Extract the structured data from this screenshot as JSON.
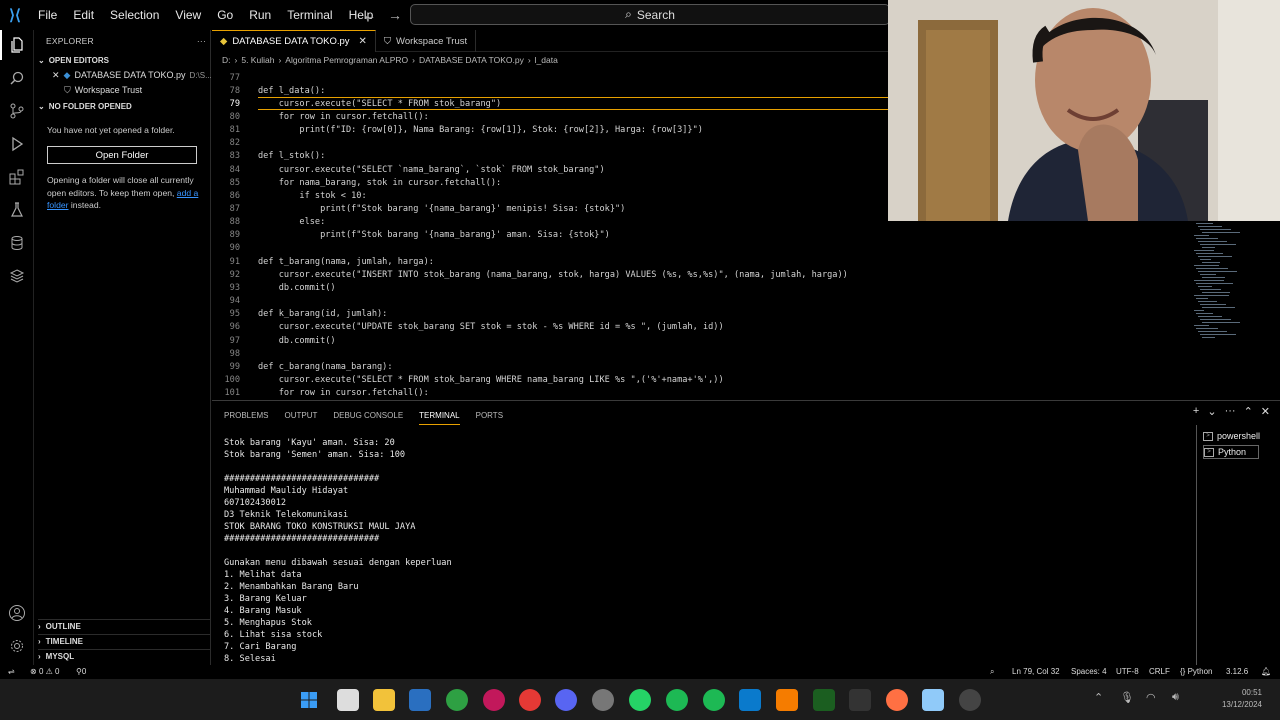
{
  "titlebar": {
    "menu": [
      "File",
      "Edit",
      "Selection",
      "View",
      "Go",
      "Run",
      "Terminal",
      "Help"
    ],
    "search": "Search"
  },
  "sidebar": {
    "title": "EXPLORER",
    "more": "···",
    "open_editors_label": "OPEN EDITORS",
    "open_editors": [
      {
        "name": "DATABASE DATA TOKO.py",
        "path": "D:\\S..."
      },
      {
        "name": "Workspace Trust",
        "path": ""
      }
    ],
    "no_folder_label": "NO FOLDER OPENED",
    "msg1": "You have not yet opened a folder.",
    "open_folder_button": "Open Folder",
    "msg2_pre": "Opening a folder will close all currently open editors. To keep them open, ",
    "msg2_link": "add a folder",
    "msg2_post": " instead.",
    "outline": "OUTLINE",
    "timeline": "TIMELINE",
    "mysql": "MYSQL"
  },
  "tabs": [
    {
      "label": "DATABASE DATA TOKO.py",
      "active": true
    },
    {
      "label": "Workspace Trust",
      "active": false
    }
  ],
  "breadcrumb": [
    "D:",
    "5. Kuliah",
    "Algoritma Pemrograman ALPRO",
    "DATABASE DATA TOKO.py",
    "l_data"
  ],
  "code": {
    "current_line": 79,
    "lines": [
      {
        "n": 77,
        "t": ""
      },
      {
        "n": 78,
        "t": "def l_data():"
      },
      {
        "n": 79,
        "t": "    cursor.execute(\"SELECT * FROM stok_barang\")"
      },
      {
        "n": 80,
        "t": "    for row in cursor.fetchall():"
      },
      {
        "n": 81,
        "t": "        print(f\"ID: {row[0]}, Nama Barang: {row[1]}, Stok: {row[2]}, Harga: {row[3]}\")"
      },
      {
        "n": 82,
        "t": ""
      },
      {
        "n": 83,
        "t": "def l_stok():"
      },
      {
        "n": 84,
        "t": "    cursor.execute(\"SELECT `nama_barang`, `stok` FROM stok_barang\")"
      },
      {
        "n": 85,
        "t": "    for nama_barang, stok in cursor.fetchall():"
      },
      {
        "n": 86,
        "t": "        if stok < 10:"
      },
      {
        "n": 87,
        "t": "            print(f\"Stok barang '{nama_barang}' menipis! Sisa: {stok}\")"
      },
      {
        "n": 88,
        "t": "        else:"
      },
      {
        "n": 89,
        "t": "            print(f\"Stok barang '{nama_barang}' aman. Sisa: {stok}\")"
      },
      {
        "n": 90,
        "t": ""
      },
      {
        "n": 91,
        "t": "def t_barang(nama, jumlah, harga):"
      },
      {
        "n": 92,
        "t": "    cursor.execute(\"INSERT INTO stok_barang (nama_barang, stok, harga) VALUES (%s, %s,%s)\", (nama, jumlah, harga))"
      },
      {
        "n": 93,
        "t": "    db.commit()"
      },
      {
        "n": 94,
        "t": ""
      },
      {
        "n": 95,
        "t": "def k_barang(id, jumlah):"
      },
      {
        "n": 96,
        "t": "    cursor.execute(\"UPDATE stok_barang SET stok = stok - %s WHERE id = %s \", (jumlah, id))"
      },
      {
        "n": 97,
        "t": "    db.commit()"
      },
      {
        "n": 98,
        "t": ""
      },
      {
        "n": 99,
        "t": "def c_barang(nama_barang):"
      },
      {
        "n": 100,
        "t": "    cursor.execute(\"SELECT * FROM stok_barang WHERE nama_barang LIKE %s \",('%'+nama+'%',))"
      },
      {
        "n": 101,
        "t": "    for row in cursor.fetchall():"
      }
    ]
  },
  "panel": {
    "tabs": [
      "PROBLEMS",
      "OUTPUT",
      "DEBUG CONSOLE",
      "TERMINAL",
      "PORTS"
    ],
    "active_tab": "TERMINAL",
    "terminals": [
      "powershell",
      "Python"
    ],
    "lines": [
      "Stok barang 'Kayu' aman. Sisa: 20",
      "Stok barang 'Semen' aman. Sisa: 100",
      "",
      "##############################",
      "Muhammad Maulidy Hidayat",
      "607102430012",
      "D3 Teknik Telekomunikasi",
      "STOK BARANG TOKO KONSTRUKSI MAUL JAYA",
      "##############################",
      "",
      "Gunakan menu dibawah sesuai dengan keperluan",
      "1. Melihat data",
      "2. Menambahkan Barang Baru",
      "3. Barang Keluar",
      "4. Barang Masuk",
      "5. Menghapus Stok",
      "6. Lihat sisa stock",
      "7. Cari Barang",
      "8. Selesai"
    ]
  },
  "statusbar": {
    "errors": "0",
    "warnings": "0",
    "ports": "0",
    "position": "Ln 79, Col 32",
    "spaces": "Spaces: 4",
    "encoding": "UTF-8",
    "eol": "CRLF",
    "language": "Python",
    "version": "3.12.6"
  },
  "taskbar": {
    "time": "00:51",
    "date": "13/12/2024"
  }
}
